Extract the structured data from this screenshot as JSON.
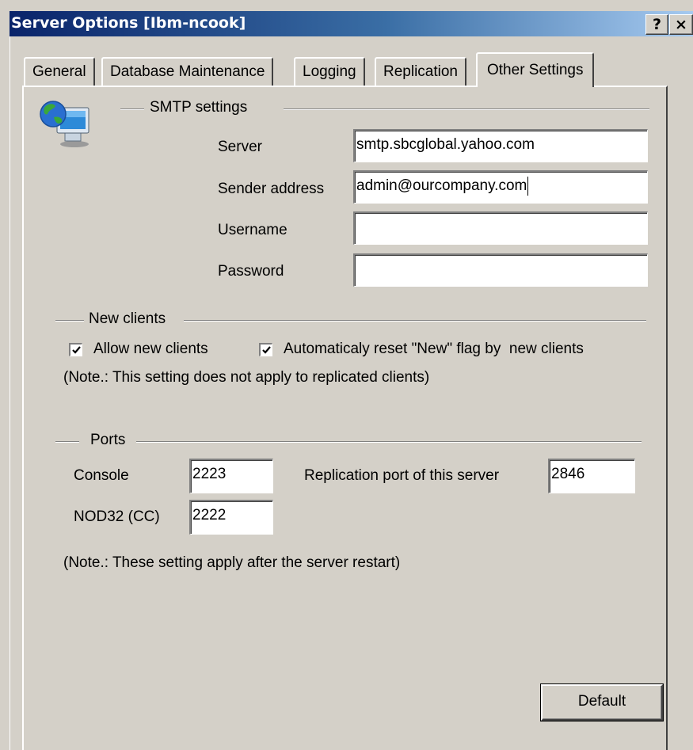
{
  "window": {
    "title": "Server Options [Ibm-ncook]",
    "help_button": "?",
    "close_button": "×"
  },
  "tabs": [
    {
      "label": "General",
      "active": false
    },
    {
      "label": "Database Maintenance",
      "active": false
    },
    {
      "label": "Logging",
      "active": false
    },
    {
      "label": "Replication",
      "active": false
    },
    {
      "label": "Other Settings",
      "active": true
    }
  ],
  "smtp": {
    "group_label": "SMTP settings",
    "icon": "network-computer-icon",
    "server_label": "Server",
    "server_value": "smtp.sbcglobal.yahoo.com",
    "sender_label": "Sender address",
    "sender_value": "admin@ourcompany.com",
    "username_label": "Username",
    "username_value": "",
    "password_label": "Password",
    "password_value": ""
  },
  "new_clients": {
    "group_label": "New clients",
    "allow_label": "Allow new clients",
    "allow_checked": true,
    "reset_label": "Automaticaly reset \"New\" flag by  new clients",
    "reset_checked": true,
    "note": "(Note.: This setting does not apply to replicated clients)"
  },
  "ports": {
    "group_label": "Ports",
    "console_label": "Console",
    "console_value": "2223",
    "replication_label": "Replication port of this server",
    "replication_value": "2846",
    "nod32_label": "NOD32 (CC)",
    "nod32_value": "2222",
    "note": "(Note.: These setting apply after the server restart)"
  },
  "buttons": {
    "default_label": "Default"
  }
}
